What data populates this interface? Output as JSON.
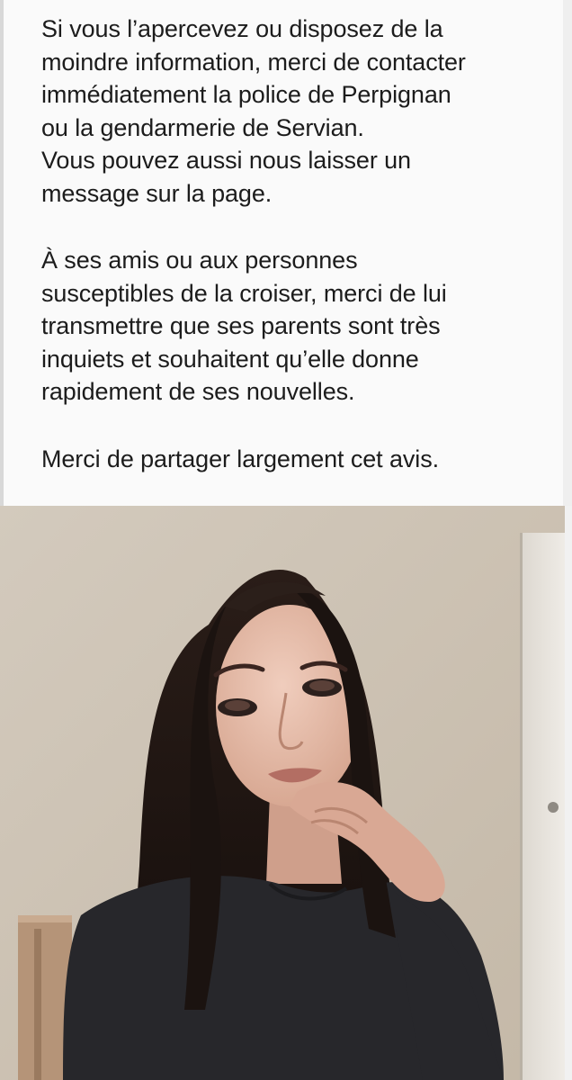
{
  "post": {
    "paragraphs": [
      {
        "lines": [
          "Si vous l’apercevez ou disposez de la",
          "moindre information, merci de contacter",
          "immédiatement la police de Perpignan",
          "ou la gendarmerie de Servian.",
          "Vous pouvez aussi nous laisser un",
          "message sur la page."
        ]
      },
      {
        "lines": [
          "À ses amis ou aux personnes",
          "susceptibles de la croiser, merci de lui",
          "transmettre que ses parents sont très",
          "inquiets et souhaitent qu’elle donne",
          "rapidement de ses nouvelles."
        ]
      },
      {
        "lines": [
          "Merci de partager largement cet avis."
        ]
      }
    ]
  },
  "photo": {
    "subject": "young woman with long dark hair wearing a black top, hand near chin",
    "colors": {
      "wall": "#cfc6b8",
      "hair": "#1e1512",
      "skin": "#e2b7a2",
      "top": "#26262a",
      "door": "#ece8e1"
    }
  }
}
